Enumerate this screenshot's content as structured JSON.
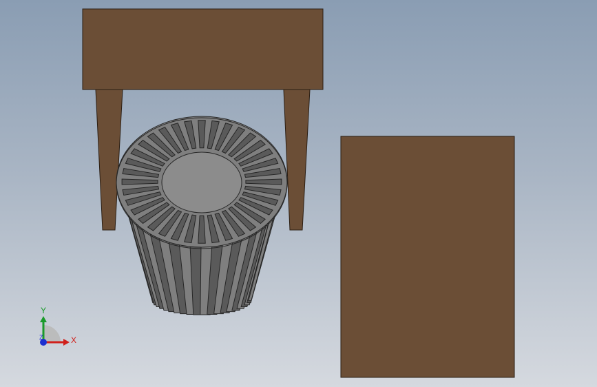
{
  "viewport": {
    "background_top": "#8a9db3",
    "background_bottom": "#d5d9df"
  },
  "colors": {
    "wood": "#6b4e36",
    "wood_edge": "#2a1d12",
    "basket_fill": "#7f7f7f",
    "basket_slot": "#5a5a5a",
    "basket_edge": "#262626",
    "axis_x": "#d0201c",
    "axis_y": "#1a9a2a",
    "axis_z": "#1c2fd0"
  },
  "triad": {
    "x_label": "X",
    "y_label": "Y",
    "z_label": "Z"
  },
  "models": {
    "table": "table-model",
    "basket": "basket-model",
    "panel": "panel-model"
  }
}
